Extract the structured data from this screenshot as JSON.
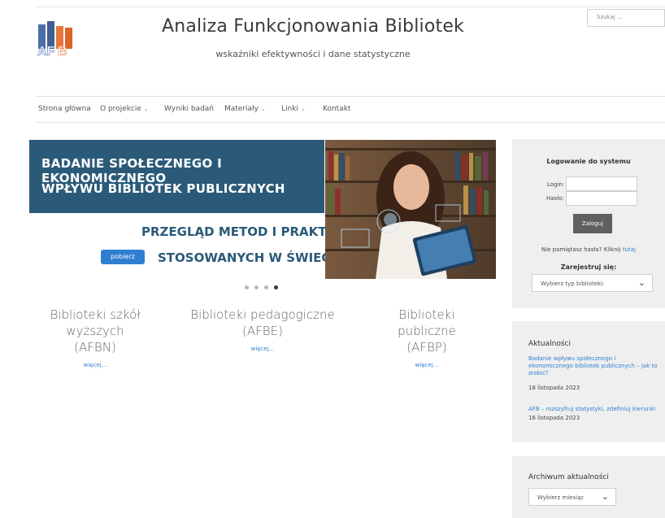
{
  "site": {
    "title": "Analiza Funkcjonowania Bibliotek",
    "tagline": "wskaźniki efektywności i dane statystyczne",
    "logo_text": "AFB",
    "search_placeholder": "Szukaj ..."
  },
  "nav": {
    "items": [
      {
        "label": "Strona główna",
        "has_dropdown": false
      },
      {
        "label": "O projekcie",
        "has_dropdown": true
      },
      {
        "label": "Wyniki badań",
        "has_dropdown": false
      },
      {
        "label": "Materiały",
        "has_dropdown": true
      },
      {
        "label": "Linki",
        "has_dropdown": true
      },
      {
        "label": "Kontakt",
        "has_dropdown": false
      }
    ]
  },
  "banner": {
    "line1": "BADANIE SPOŁECZNEGO I EKONOMICZNEGO",
    "line2": "WPŁYWU BIBLIOTEK PUBLICZNYCH",
    "sub1": "PRZEGLĄD METOD I PRAKTYK",
    "sub2": "STOSOWANYCH W ŚWIECIE",
    "button": "pobierz",
    "slides": 4,
    "active_slide": 4
  },
  "columns": [
    {
      "line1": "Biblioteki szkół",
      "line2": "wyższych",
      "line3": "(AFBN)",
      "more": "więcej..."
    },
    {
      "line1": "Biblioteki pedagogiczne",
      "line2": "(AFBE)",
      "line3": "",
      "more": "więcej..."
    },
    {
      "line1": "Biblioteki",
      "line2": "publiczne",
      "line3": "(AFBP)",
      "more": "więcej..."
    }
  ],
  "login": {
    "title": "Logowanie do systemu",
    "login_label": "Login:",
    "password_label": "Hasło:",
    "button": "Zaloguj",
    "forgot_text": "Nie pamiętasz hasła? Kliknij",
    "forgot_link": "tutaj",
    "register_label": "Zarejestruj się:",
    "library_type_placeholder": "Wybierz typ biblioteki:"
  },
  "news": {
    "title": "Aktualności",
    "items": [
      {
        "title": "Badanie wpływu społecznego i ekonomicznego bibliotek publicznych – jak to zrobić?",
        "date": "18 listopada 2023"
      },
      {
        "title": "AFB – rozszyfruj statystyki, zdefiniuj kierunki",
        "date": "16 listopada 2023"
      }
    ]
  },
  "archive": {
    "title": "Archiwum aktualności",
    "select_placeholder": "Wybierz miesiąc"
  },
  "colors": {
    "banner_blue": "#2a5a78",
    "link_blue": "#2f7fd1",
    "sidebar_bg": "#efefef",
    "button_gray": "#5f5f5f",
    "logo_blue": "#4a6fa5",
    "logo_orange": "#e8763a"
  }
}
